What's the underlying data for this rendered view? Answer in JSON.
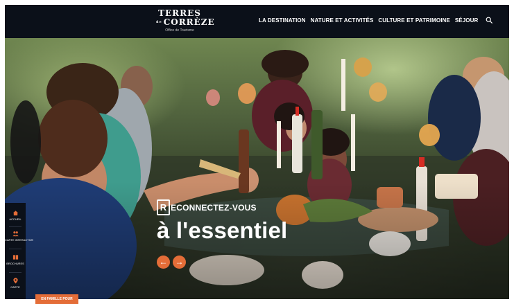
{
  "header": {
    "logo": {
      "line1": "TERRES",
      "line2_prefix": "de",
      "line2": "CORRÈZE",
      "tagline": "Office de Tourisme"
    },
    "nav": [
      {
        "label": "LA DESTINATION"
      },
      {
        "label": "NATURE ET ACTIVITÉS"
      },
      {
        "label": "CULTURE ET PATRIMOINE"
      },
      {
        "label": "SÉJOUR"
      }
    ],
    "search_icon": "search-icon"
  },
  "hero": {
    "tagline_top": "ECONNECTEZ-VOUS",
    "tagline_letter": "R",
    "tagline_main": "à l'essentiel",
    "arrows": {
      "prev": "←",
      "next": "→"
    }
  },
  "sidebar": {
    "items": [
      {
        "label": "ACCUEIL",
        "icon": "home-icon"
      },
      {
        "label": "CARTE INTERACTIVE",
        "icon": "people-icon"
      },
      {
        "label": "BROCHURES",
        "icon": "book-icon"
      },
      {
        "label": "CARTE",
        "icon": "map-pin-icon"
      }
    ]
  },
  "cta": {
    "label": "EN FAMILLE POUR"
  },
  "colors": {
    "brand_dark": "#0b1019",
    "accent_orange": "#e46d38",
    "text_white": "#ffffff"
  }
}
